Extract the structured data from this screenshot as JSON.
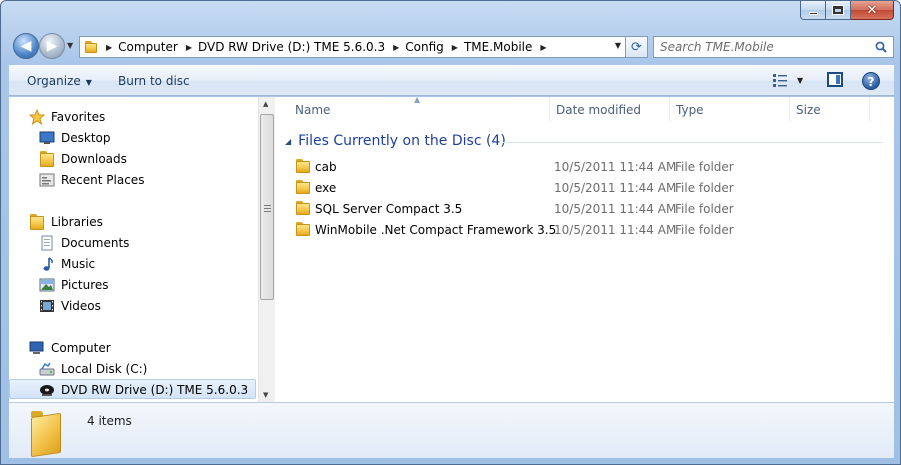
{
  "window": {
    "caption_buttons": {
      "minimize": "minimize",
      "maximize": "maximize",
      "close": "✕"
    }
  },
  "nav": {
    "back_glyph": "◀",
    "forward_glyph": "▶",
    "address": {
      "crumbs": [
        "Computer",
        "DVD RW Drive (D:) TME 5.6.0.3",
        "Config",
        "TME.Mobile"
      ]
    },
    "search": {
      "placeholder": "Search TME.Mobile"
    }
  },
  "toolbar": {
    "organize_label": "Organize",
    "burn_label": "Burn to disc",
    "help_glyph": "?"
  },
  "navpane": {
    "favorites": {
      "label": "Favorites",
      "items": [
        {
          "label": "Desktop",
          "icon": "desktop-icon"
        },
        {
          "label": "Downloads",
          "icon": "downloads-icon"
        },
        {
          "label": "Recent Places",
          "icon": "recent-places-icon"
        }
      ]
    },
    "libraries": {
      "label": "Libraries",
      "items": [
        {
          "label": "Documents",
          "icon": "documents-icon"
        },
        {
          "label": "Music",
          "icon": "music-icon"
        },
        {
          "label": "Pictures",
          "icon": "pictures-icon"
        },
        {
          "label": "Videos",
          "icon": "videos-icon"
        }
      ]
    },
    "computer": {
      "label": "Computer",
      "items": [
        {
          "label": "Local Disk (C:)",
          "icon": "local-disk-icon"
        },
        {
          "label": "DVD RW Drive (D:) TME 5.6.0.3",
          "icon": "dvd-drive-icon",
          "selected": true
        }
      ]
    }
  },
  "content": {
    "columns": [
      "Name",
      "Date modified",
      "Type",
      "Size"
    ],
    "group": {
      "title": "Files Currently on the Disc (4)"
    },
    "rows": [
      {
        "name": "cab",
        "date": "10/5/2011 11:44 AM",
        "type": "File folder"
      },
      {
        "name": "exe",
        "date": "10/5/2011 11:44 AM",
        "type": "File folder"
      },
      {
        "name": "SQL Server Compact 3.5",
        "date": "10/5/2011 11:44 AM",
        "type": "File folder"
      },
      {
        "name": "WinMobile .Net Compact Framework 3.5",
        "date": "10/5/2011 11:44 AM",
        "type": "File folder"
      }
    ]
  },
  "details": {
    "count": "4 items"
  },
  "colors": {
    "accent": "#1e3f9e",
    "frame": "#b9d1ee",
    "selection": "#d2e4f7"
  }
}
